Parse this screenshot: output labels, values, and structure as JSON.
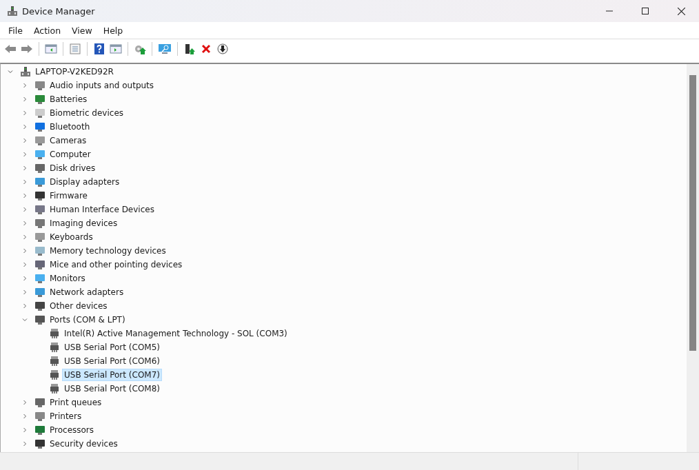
{
  "window": {
    "title": "Device Manager"
  },
  "menu": [
    "File",
    "Action",
    "View",
    "Help"
  ],
  "tree": {
    "label": "LAPTOP-V2KED92R",
    "expanded": true,
    "children": [
      {
        "label": "Audio inputs and outputs",
        "expanded": false
      },
      {
        "label": "Batteries",
        "expanded": false
      },
      {
        "label": "Biometric devices",
        "expanded": false
      },
      {
        "label": "Bluetooth",
        "expanded": false
      },
      {
        "label": "Cameras",
        "expanded": false
      },
      {
        "label": "Computer",
        "expanded": false
      },
      {
        "label": "Disk drives",
        "expanded": false
      },
      {
        "label": "Display adapters",
        "expanded": false
      },
      {
        "label": "Firmware",
        "expanded": false
      },
      {
        "label": "Human Interface Devices",
        "expanded": false
      },
      {
        "label": "Imaging devices",
        "expanded": false
      },
      {
        "label": "Keyboards",
        "expanded": false
      },
      {
        "label": "Memory technology devices",
        "expanded": false
      },
      {
        "label": "Mice and other pointing devices",
        "expanded": false
      },
      {
        "label": "Monitors",
        "expanded": false
      },
      {
        "label": "Network adapters",
        "expanded": false
      },
      {
        "label": "Other devices",
        "expanded": false
      },
      {
        "label": "Ports (COM & LPT)",
        "expanded": true,
        "children": [
          {
            "label": "Intel(R) Active Management Technology - SOL (COM3)",
            "selected": false
          },
          {
            "label": "USB Serial Port (COM5)",
            "selected": false
          },
          {
            "label": "USB Serial Port (COM6)",
            "selected": false
          },
          {
            "label": "USB Serial Port (COM7)",
            "selected": true
          },
          {
            "label": "USB Serial Port (COM8)",
            "selected": false
          }
        ]
      },
      {
        "label": "Print queues",
        "expanded": false
      },
      {
        "label": "Printers",
        "expanded": false
      },
      {
        "label": "Processors",
        "expanded": false
      },
      {
        "label": "Security devices",
        "expanded": false
      }
    ]
  }
}
